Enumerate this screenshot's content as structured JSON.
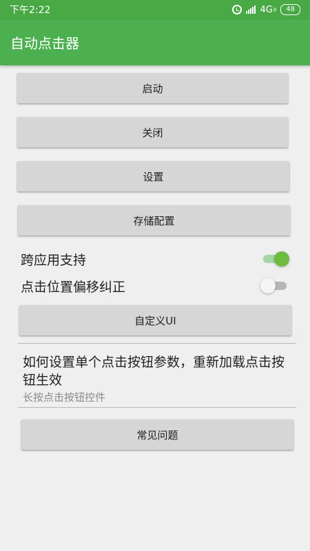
{
  "status_bar": {
    "time": "下午2:22",
    "network": "4G",
    "network_sub": "ll",
    "battery": "48"
  },
  "app_bar": {
    "title": "自动点击器"
  },
  "buttons": {
    "start": "启动",
    "close": "关闭",
    "settings": "设置",
    "save_config": "存储配置",
    "custom_ui": "自定义UI",
    "faq": "常见问题"
  },
  "toggles": [
    {
      "label": "跨应用支持",
      "on": true
    },
    {
      "label": "点击位置偏移纠正",
      "on": false
    }
  ],
  "info": {
    "title": "如何设置单个点击按钮参数，重新加载点击按钮生效",
    "subtitle": "长按点击按钮控件"
  },
  "colors": {
    "app_bar": "#4caf50",
    "status_bar": "#48a945",
    "switch_on": "#6dbb3f",
    "button": "#d6d6d6"
  }
}
